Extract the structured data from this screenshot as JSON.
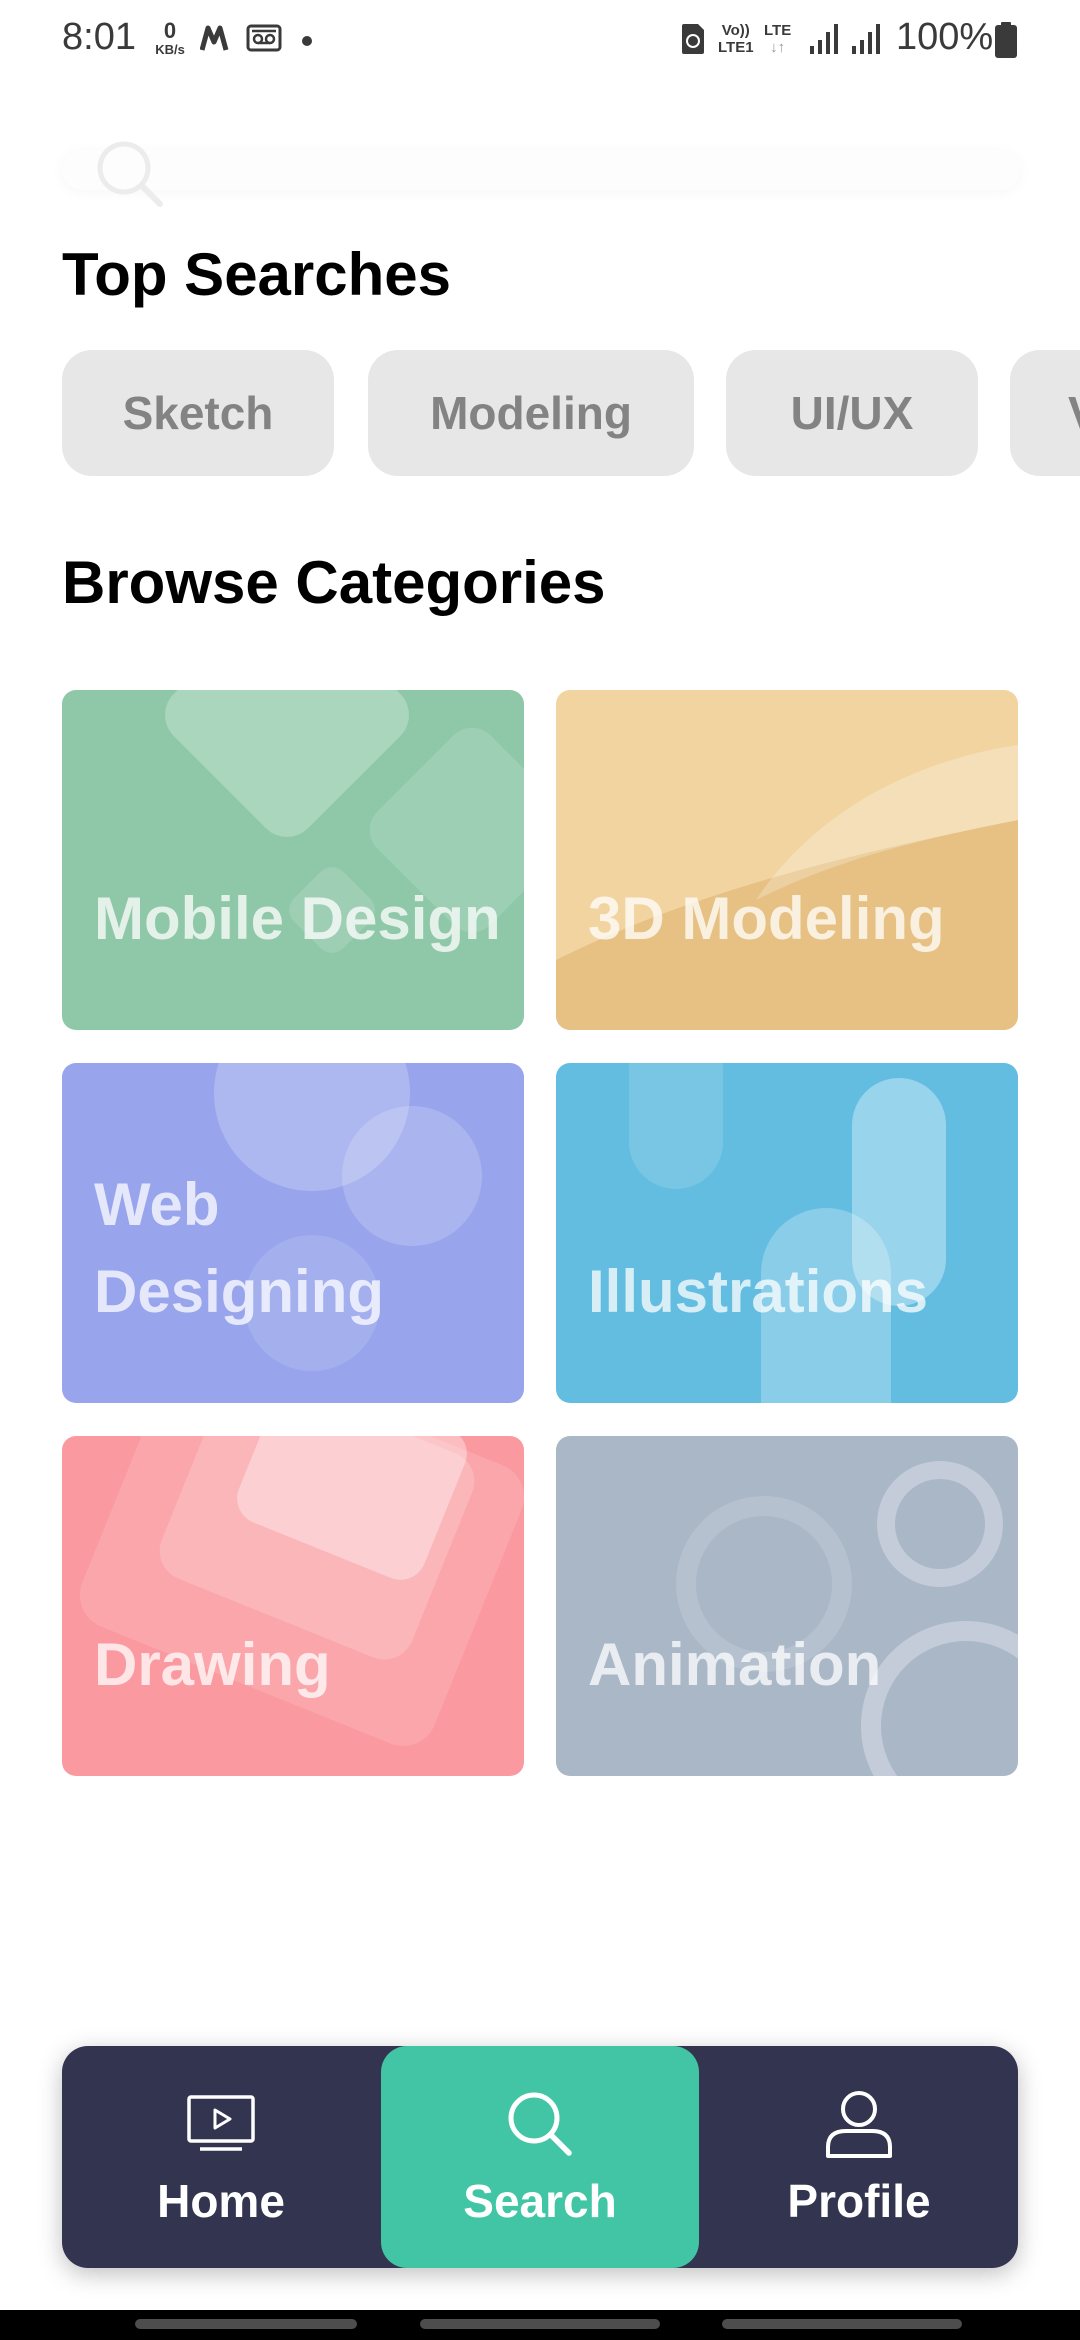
{
  "status_bar": {
    "time": "8:01",
    "net_speed_value": "0",
    "net_speed_unit": "KB/s",
    "volte_line1": "Vo))",
    "volte_line2": "LTE1",
    "lte_label": "LTE",
    "battery_text": "100%"
  },
  "search": {
    "placeholder": ""
  },
  "top_searches": {
    "title": "Top Searches",
    "chips": [
      "Sketch",
      "Modeling",
      "UI/UX",
      "V"
    ]
  },
  "browse": {
    "title": "Browse Categories",
    "categories": [
      {
        "label": "Mobile Design",
        "color": "#8ec8a8"
      },
      {
        "label": "3D Modeling",
        "color": "#f2d4a1"
      },
      {
        "label": "Web Designing",
        "color": "#98a4ec"
      },
      {
        "label": "Illustrations",
        "color": "#62bde0"
      },
      {
        "label": "Drawing",
        "color": "#fa9aa0"
      },
      {
        "label": "Animation",
        "color": "#a9b7c7"
      }
    ]
  },
  "bottom_nav": {
    "items": [
      {
        "label": "Home",
        "icon": "tv-play-icon",
        "active": false
      },
      {
        "label": "Search",
        "icon": "search-icon",
        "active": true
      },
      {
        "label": "Profile",
        "icon": "user-icon",
        "active": false
      }
    ],
    "bar_color": "#333450",
    "accent_color": "#42c5a5"
  }
}
